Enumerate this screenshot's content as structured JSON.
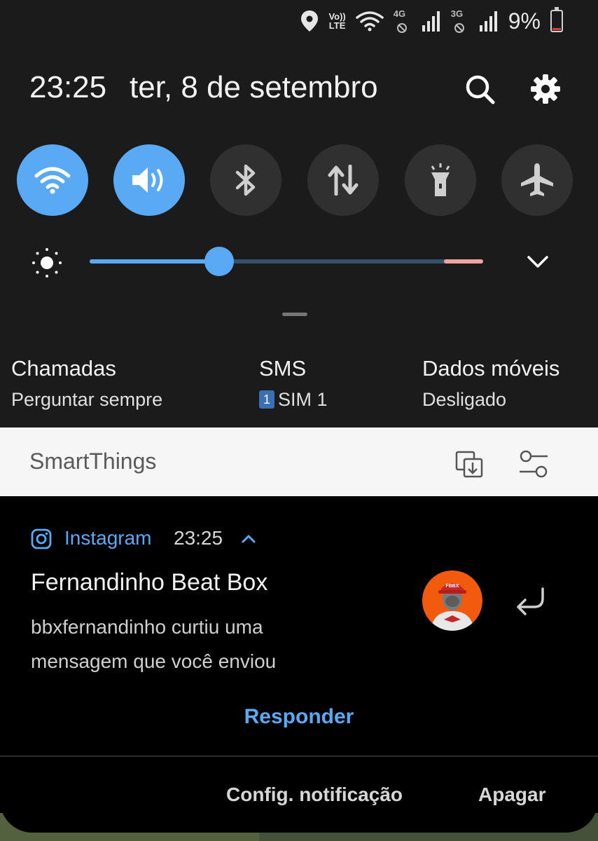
{
  "status_bar": {
    "volte_label": "Vo))",
    "lte_label": "LTE",
    "sim1_gen": "4G",
    "sim2_gen": "3G",
    "battery_percent": "9%",
    "battery_level_fraction": 0.09,
    "icons": [
      "location-icon",
      "volte-icon",
      "wifi-icon",
      "signal-icon",
      "battery-icon"
    ]
  },
  "header": {
    "time": "23:25",
    "date": "ter, 8 de setembro",
    "icons": [
      "search-icon",
      "settings-icon"
    ]
  },
  "quick_toggles": [
    {
      "name": "wifi",
      "icon": "wifi-icon",
      "on": true
    },
    {
      "name": "sound",
      "icon": "volume-icon",
      "on": true
    },
    {
      "name": "bluetooth",
      "icon": "bluetooth-icon",
      "on": false
    },
    {
      "name": "mobile-data",
      "icon": "data-arrows-icon",
      "on": false
    },
    {
      "name": "flashlight",
      "icon": "flashlight-icon",
      "on": false
    },
    {
      "name": "airplane",
      "icon": "airplane-icon",
      "on": false
    }
  ],
  "brightness": {
    "icon": "brightness-sun-icon",
    "level": 0.33
  },
  "sim_info": {
    "calls_title": "Chamadas",
    "calls_value": "Perguntar sempre",
    "sms_title": "SMS",
    "sms_sim_badge": "1",
    "sms_value": "SIM 1",
    "data_title": "Dados móveis",
    "data_value": "Desligado"
  },
  "smartthings": {
    "label": "SmartThings",
    "icons": [
      "device-link-icon",
      "filter-settings-icon"
    ]
  },
  "notification": {
    "app_name": "Instagram",
    "time": "23:25",
    "title": "Fernandinho Beat Box",
    "body": "bbxfernandinho curtiu uma mensagem que você enviou",
    "avatar_text": "FBBX",
    "reply_label": "Responder",
    "action_settings": "Config. notificação",
    "action_clear": "Apagar"
  },
  "colors": {
    "accent": "#5aa9f5",
    "panel_bg": "#1b1b1b",
    "toggle_off": "#303030",
    "avatar_bg": "#f25a0e",
    "battery_low": "#e53935"
  }
}
